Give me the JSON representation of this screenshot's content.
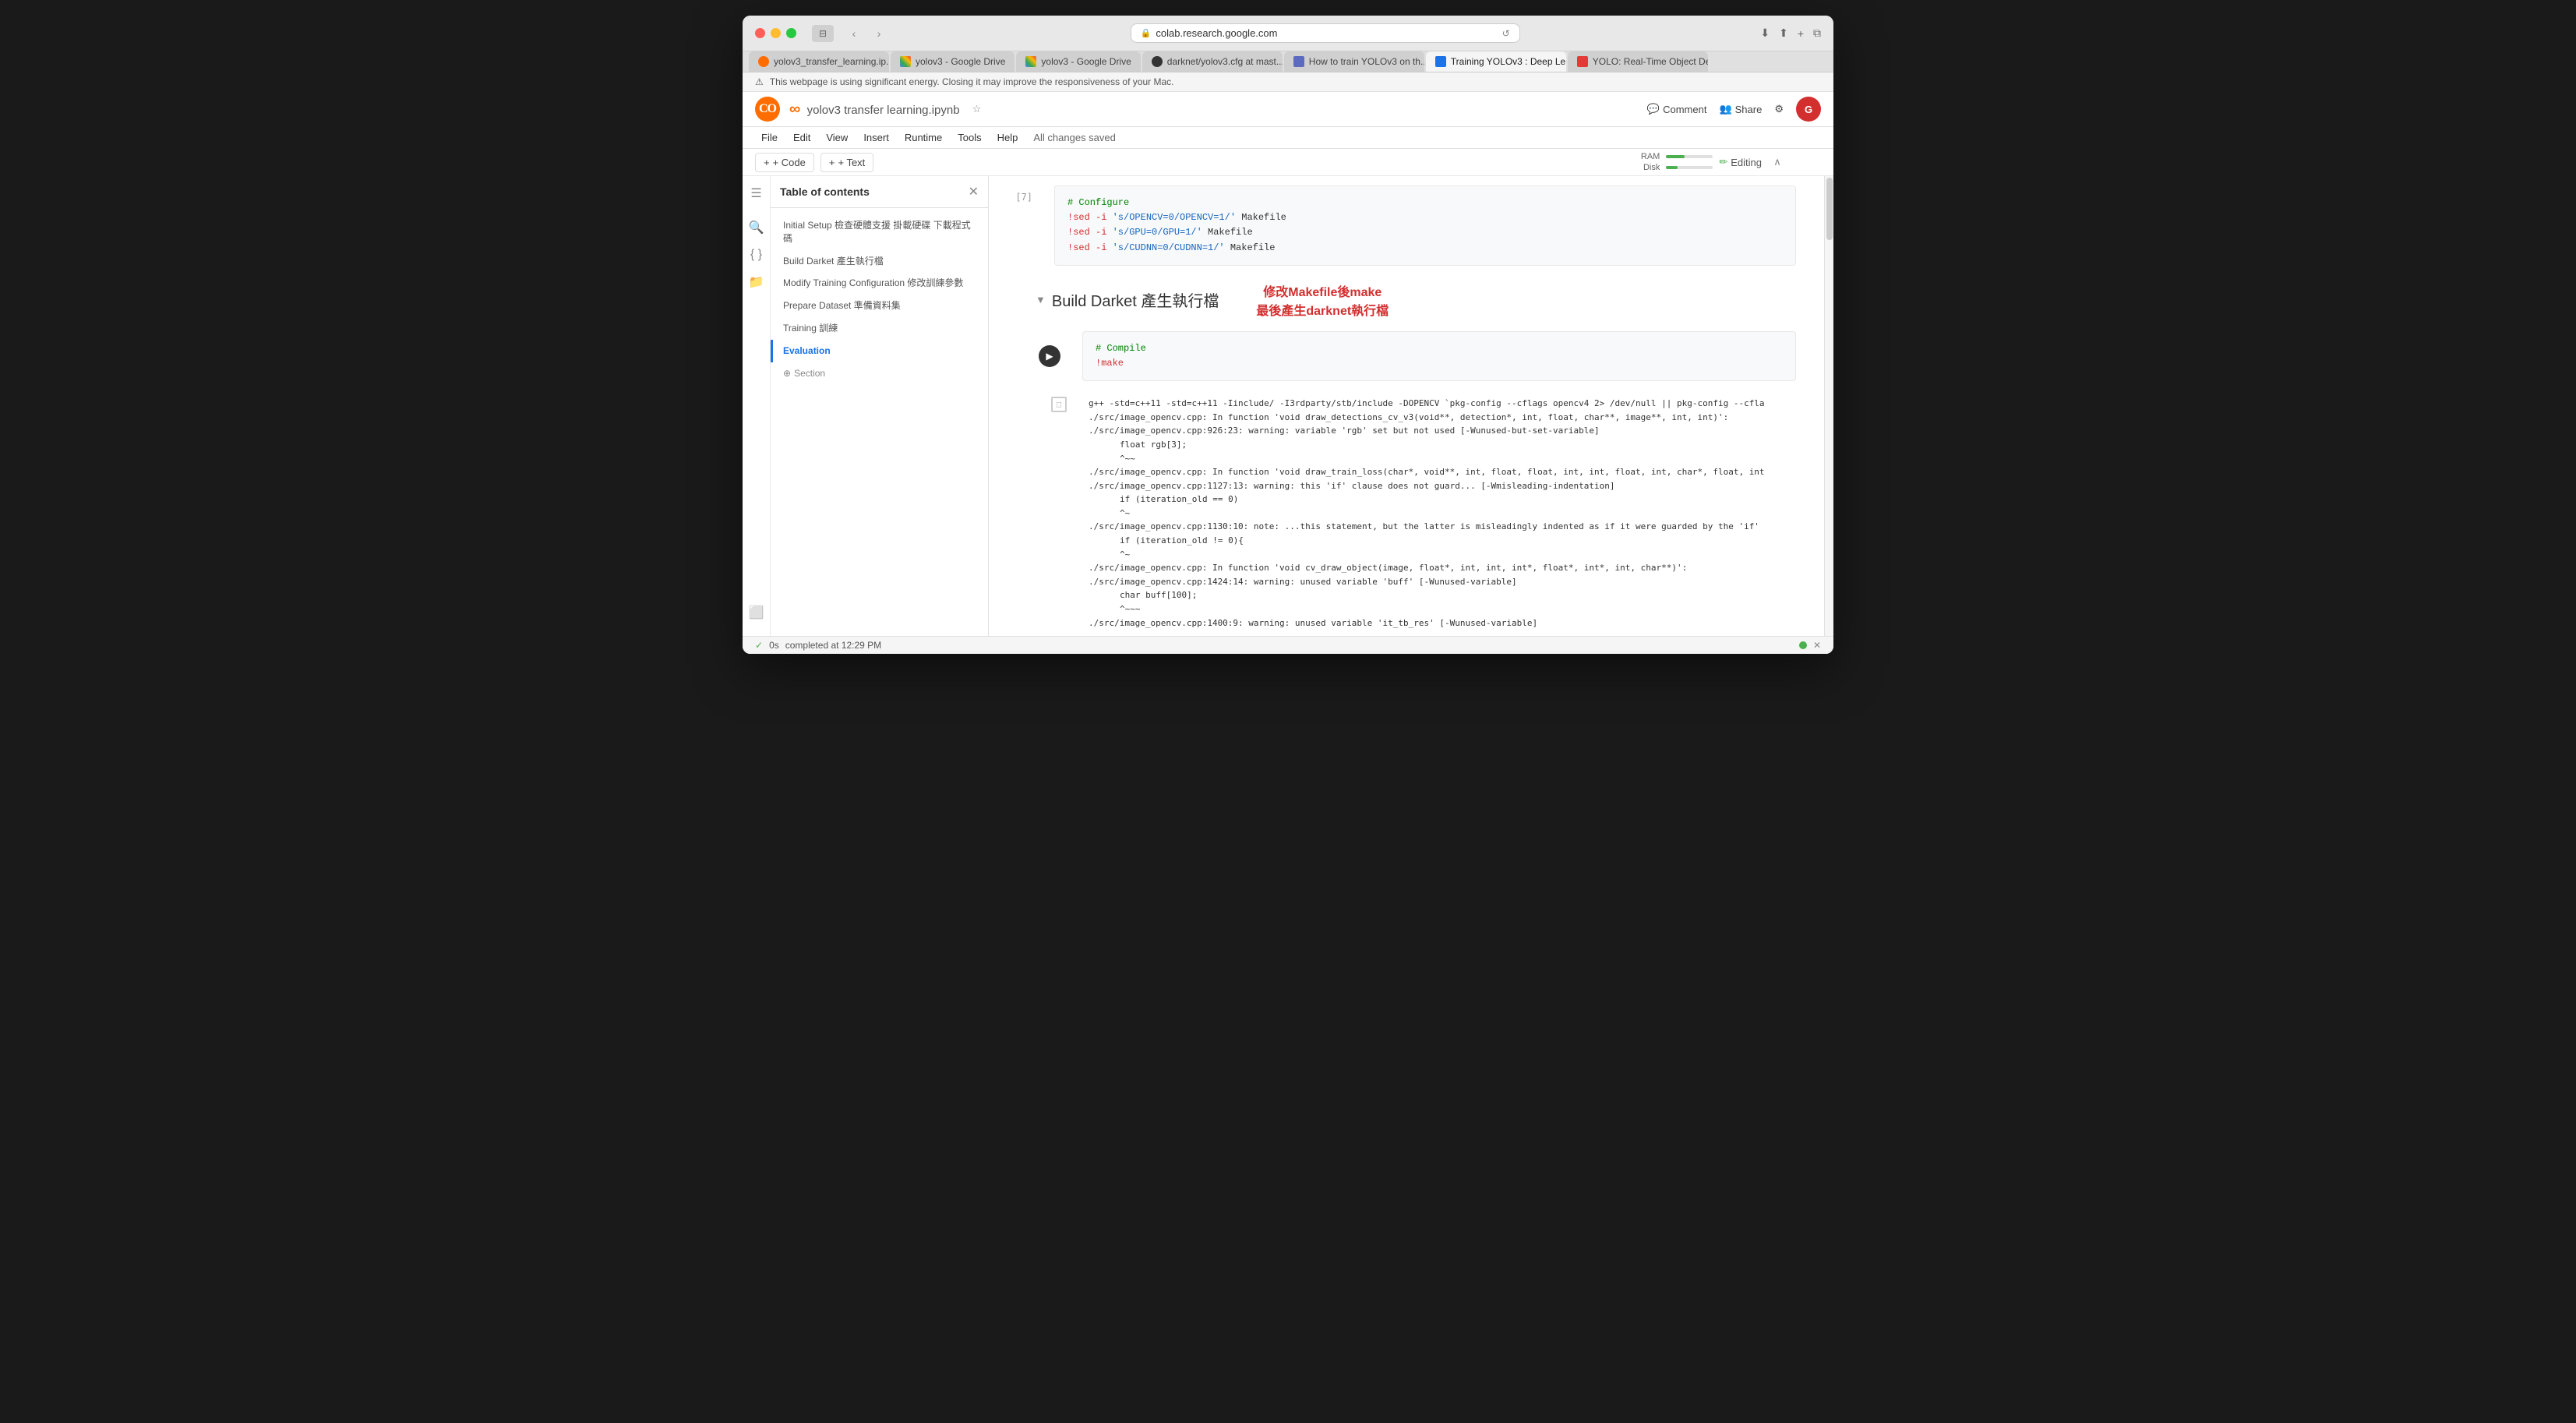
{
  "browser": {
    "url": "colab.research.google.com",
    "warning": "This webpage is using significant energy. Closing it may improve the responsiveness of your Mac."
  },
  "tabs": [
    {
      "label": "yolov3_transfer_learning.ip...",
      "type": "colab",
      "active": false
    },
    {
      "label": "yolov3 - Google Drive",
      "type": "drive",
      "active": false
    },
    {
      "label": "yolov3 - Google Drive",
      "type": "drive",
      "active": false
    },
    {
      "label": "darknet/yolov3.cfg at mast...",
      "type": "github",
      "active": false
    },
    {
      "label": "How to train YOLOv3 on th...",
      "type": "generic",
      "active": false
    },
    {
      "label": "Training YOLOv3 : Deep Le...",
      "type": "generic",
      "active": true
    },
    {
      "label": "YOLO: Real-Time Object De...",
      "type": "generic",
      "active": false
    }
  ],
  "notebook": {
    "title": "yolov3  transfer  learning.ipynb",
    "saved_status": "All changes saved"
  },
  "menu": {
    "items": [
      "File",
      "Edit",
      "View",
      "Insert",
      "Runtime",
      "Tools",
      "Help"
    ]
  },
  "toolbar": {
    "code_btn": "+ Code",
    "text_btn": "+ Text",
    "ram_label": "RAM",
    "disk_label": "Disk",
    "editing_label": "Editing"
  },
  "sidebar": {
    "title": "Table of contents",
    "items": [
      {
        "label": "Initial Setup 檢查硬體支援 掛載硬碟 下載程式碼",
        "level": 0,
        "active": false
      },
      {
        "label": "Build Darket 產生執行檔",
        "level": 0,
        "active": false
      },
      {
        "label": "Modify Training Configuration 修改訓練參數",
        "level": 0,
        "active": false
      },
      {
        "label": "Prepare Dataset 準備資料集",
        "level": 0,
        "active": false
      },
      {
        "label": "Training 訓練",
        "level": 0,
        "active": false
      },
      {
        "label": "Evaluation",
        "level": 0,
        "active": true
      },
      {
        "label": "Section",
        "level": 0,
        "active": false,
        "is_add": true
      }
    ]
  },
  "cells": [
    {
      "type": "code",
      "cell_number": "[7]",
      "comment": "# Configure",
      "lines": [
        "!sed -i 's/OPENCV=0/OPENCV=1/' Makefile",
        "!sed -i 's/GPU=0/GPU=1/' Makefile",
        "!sed -i 's/CUDNN=0/CUDNN=1/' Makefile"
      ]
    },
    {
      "type": "section",
      "title": "Build Darket 產生執行檔",
      "annotation": "修改Makefile後make\n最後產生darknet執行檔"
    },
    {
      "type": "code",
      "cell_number": "",
      "comment": "# Compile",
      "lines": [
        "!make"
      ]
    },
    {
      "type": "output",
      "lines": [
        "g++ -std=c++11 -std=c++11 -Iinclude/ -I3rdparty/stb/include -DOPENCV `pkg-config --cflags opencv4 2> /dev/null || pkg-config --cfla",
        "./src/image_opencv.cpp: In function 'void draw_detections_cv_v3(void**, detection*, int, float, char**, image**, int, int)':",
        "./src/image_opencv.cpp:926:23: warning: variable 'rgb' set but not used [-Wunused-but-set-variable]",
        "                float rgb[3];",
        "                ^~~",
        "./src/image_opencv.cpp: In function 'void draw_train_loss(char*, void**, int, float, float, int, int, float, int, char*, float, int",
        "./src/image_opencv.cpp:1127:13: warning: this 'if' clause does not guard... [-Wmisleading-indentation]",
        "             if (iteration_old == 0)",
        "             ^~",
        "./src/image_opencv.cpp:1130:10: note: ...this statement, but the latter is misleadingly indented as if it were guarded by the 'if'",
        "          if (iteration_old != 0){",
        "          ^~",
        "./src/image_opencv.cpp: In function 'void cv_draw_object(image, float*, int, int, int*, float*, int*, int, char**)':",
        "./src/image_opencv.cpp:1424:14: warning: unused variable 'buff' [-Wunused-variable]",
        "                char buff[100];",
        "                ^~~~",
        "./src/image_opencv.cpp:1400:9: warning: unused variable 'it_tb_res' [-Wunused-variable]"
      ]
    }
  ],
  "status_bar": {
    "check_icon": "✓",
    "time_text": "0s",
    "completed_text": "completed at 12:29 PM"
  }
}
